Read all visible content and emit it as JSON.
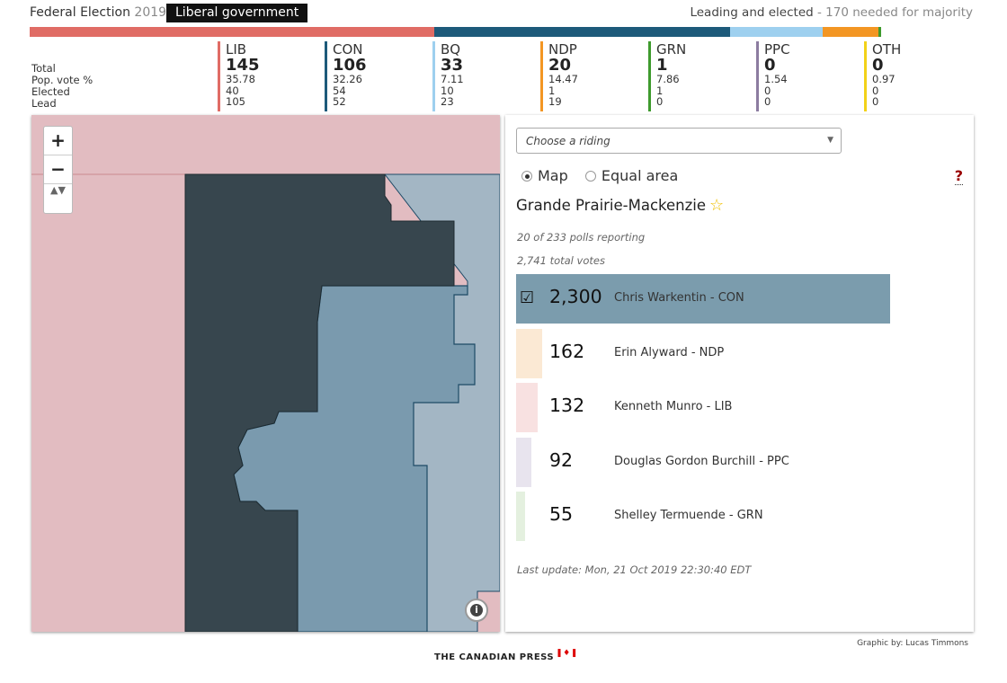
{
  "header": {
    "title_main": "Federal Election",
    "title_year": "2019",
    "gov_badge": "Liberal government",
    "majority_main": "Leading and elected",
    "majority_sub": "- 170 needed for majority"
  },
  "colors": {
    "LIB": "#e06c65",
    "CON": "#1d5a7a",
    "BQ": "#9ed0ef",
    "NDP": "#f39623",
    "GRN": "#3e9a2d",
    "PPC": "#8c7ca0",
    "OTH": "#f2d219"
  },
  "seat_totals": [
    {
      "party": "LIB",
      "seats": 145,
      "color": "#e06c65"
    },
    {
      "party": "CON",
      "seats": 106,
      "color": "#1d5a7a"
    },
    {
      "party": "BQ",
      "seats": 33,
      "color": "#9ed0ef"
    },
    {
      "party": "NDP",
      "seats": 20,
      "color": "#f39623"
    },
    {
      "party": "GRN",
      "seats": 1,
      "color": "#3e9a2d"
    }
  ],
  "row_labels": {
    "total": "Total",
    "popvote": "Pop. vote %",
    "elected": "Elected",
    "lead": "Lead"
  },
  "parties": [
    {
      "abbr": "LIB",
      "total": "145",
      "popvote": "35.78",
      "elected": "40",
      "lead": "105",
      "color": "#e06c65"
    },
    {
      "abbr": "CON",
      "total": "106",
      "popvote": "32.26",
      "elected": "54",
      "lead": "52",
      "color": "#1d5a7a"
    },
    {
      "abbr": "BQ",
      "total": "33",
      "popvote": "7.11",
      "elected": "10",
      "lead": "23",
      "color": "#9ed0ef"
    },
    {
      "abbr": "NDP",
      "total": "20",
      "popvote": "14.47",
      "elected": "1",
      "lead": "19",
      "color": "#f39623"
    },
    {
      "abbr": "GRN",
      "total": "1",
      "popvote": "7.86",
      "elected": "1",
      "lead": "0",
      "color": "#3e9a2d"
    },
    {
      "abbr": "PPC",
      "total": "0",
      "popvote": "1.54",
      "elected": "0",
      "lead": "0",
      "color": "#8c7ca0"
    },
    {
      "abbr": "OTH",
      "total": "0",
      "popvote": "0.97",
      "elected": "0",
      "lead": "0",
      "color": "#f2d219"
    }
  ],
  "map": {
    "zoom_in": "+",
    "zoom_out": "−",
    "reset": "▲▼",
    "info": "i"
  },
  "panel": {
    "select_placeholder": "Choose a riding",
    "select_arrow": "▼",
    "radio_map": "Map",
    "radio_equal": "Equal area",
    "help": "?",
    "riding_name": "Grande Prairie-Mackenzie",
    "star": "☆",
    "polls": "20 of 233 polls reporting",
    "total_votes": "2,741 total votes",
    "check": "☑",
    "last_update": "Last update: Mon, 21 Oct 2019 22:30:40 EDT"
  },
  "candidates": [
    {
      "votes": "2,300",
      "name": "Chris Warkentin - CON",
      "share": 0.839,
      "color": "#7b9cad",
      "winner": true
    },
    {
      "votes": "162",
      "name": "Erin Alyward - NDP",
      "share": 0.059,
      "color": "#fbe9d4",
      "winner": false
    },
    {
      "votes": "132",
      "name": "Kenneth Munro - LIB",
      "share": 0.048,
      "color": "#f8e1e1",
      "winner": false
    },
    {
      "votes": "92",
      "name": "Douglas Gordon Burchill - PPC",
      "share": 0.034,
      "color": "#e8e4ee",
      "winner": false
    },
    {
      "votes": "55",
      "name": "Shelley Termuende - GRN",
      "share": 0.02,
      "color": "#e4f0df",
      "winner": false
    }
  ],
  "credit": "Graphic by: Lucas Timmons",
  "footer": {
    "label": "THE CANADIAN PRESS",
    "flag": "❚♦❚"
  }
}
